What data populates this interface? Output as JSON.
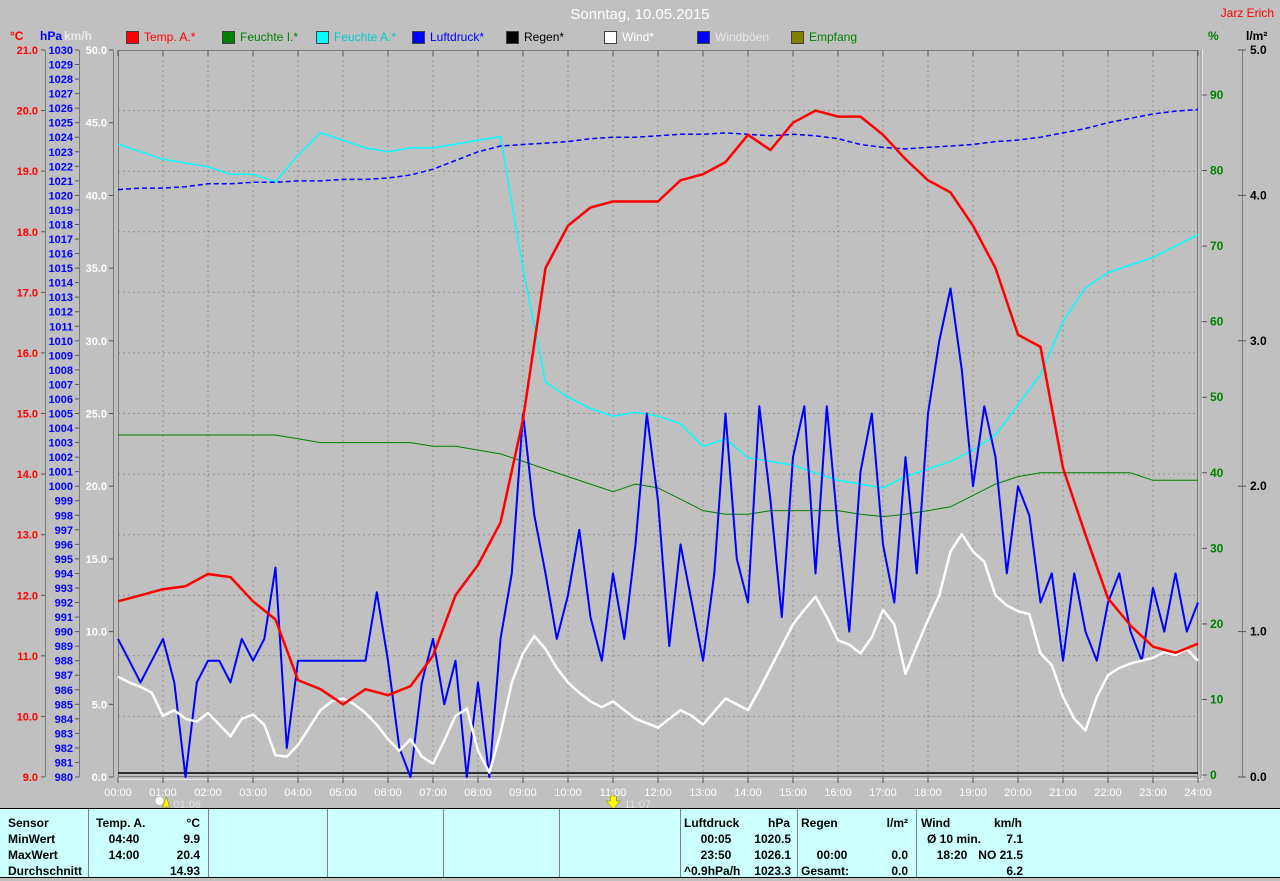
{
  "window": {
    "title": "Sonntag, 10.05.2015",
    "author": "Jarz Erich"
  },
  "header": {
    "units_left": [
      {
        "label": "°C",
        "color": "#ff0000"
      },
      {
        "label": "hPa",
        "color": "#0000ff"
      },
      {
        "label": "km/h",
        "color": "#e8e8e8"
      }
    ],
    "units_right": [
      {
        "label": "%",
        "color": "#008000"
      },
      {
        "label": "l/m²",
        "color": "#000000"
      }
    ]
  },
  "legend": {
    "items": [
      {
        "label": "Temp. A.*",
        "swatch": "#ff0000",
        "text_color": "#ff0000"
      },
      {
        "label": "Feuchte I.*",
        "swatch": "#008000",
        "text_color": "#008000"
      },
      {
        "label": "Feuchte A.*",
        "swatch": "#00ffff",
        "text_color": "#00cccc"
      },
      {
        "label": "Luftdruck*",
        "swatch": "#0000ff",
        "text_color": "#0000ff"
      },
      {
        "label": "Regen*",
        "swatch": "#000000",
        "text_color": "#000000"
      },
      {
        "label": "Wind*",
        "swatch": "#ffffff",
        "text_color": "#ffffff"
      },
      {
        "label": "Windböen",
        "swatch": "#0000ff",
        "text_color": "#e8e8e8"
      },
      {
        "label": "Empfang",
        "swatch": "#808000",
        "text_color": "#008000"
      }
    ]
  },
  "markers": [
    {
      "time": "01:06",
      "icon": "moon-marker"
    },
    {
      "time": "11:07",
      "icon": "down-arrow-marker"
    }
  ],
  "chart_data": {
    "type": "line",
    "title": "Sonntag, 10.05.2015",
    "x": {
      "start_h": 0,
      "end_h": 24,
      "tick_step_h": 1,
      "tick_labels_format": "HH:00"
    },
    "grid": {
      "vertical": "hourly",
      "horizontal": "every 1 °C",
      "style": "dashed"
    },
    "axes": {
      "temp": {
        "unit": "°C",
        "min": 9,
        "max": 21,
        "step": 1,
        "color": "#ff0000",
        "side": "left"
      },
      "pressure": {
        "unit": "hPa",
        "min": 980,
        "max": 1030,
        "step": 1,
        "color": "#0000ff",
        "side": "left"
      },
      "wind": {
        "unit": "km/h",
        "min": 0,
        "max": 50,
        "step": 5,
        "color": "#ffffff",
        "side": "left"
      },
      "humidity": {
        "unit": "%",
        "min": 0,
        "max": 90,
        "step": 10,
        "color": "#008000",
        "side": "right"
      },
      "rain": {
        "unit": "l/m²",
        "min": 0,
        "max": 5,
        "step": 1,
        "color": "#000000",
        "side": "right"
      }
    },
    "series": [
      {
        "name": "Temp. A.",
        "axis": "temp",
        "color": "#ff0000",
        "width": 2.5,
        "style": "solid",
        "step_min": 30,
        "values": [
          11.9,
          12.0,
          12.1,
          12.15,
          12.35,
          12.3,
          11.9,
          11.6,
          10.6,
          10.45,
          10.2,
          10.45,
          10.35,
          10.5,
          11.0,
          12.0,
          12.5,
          13.2,
          14.9,
          17.4,
          18.1,
          18.4,
          18.5,
          18.5,
          18.5,
          18.85,
          18.95,
          19.15,
          19.6,
          19.35,
          19.8,
          20.0,
          19.9,
          19.9,
          19.6,
          19.2,
          18.85,
          18.65,
          18.1,
          17.4,
          16.3,
          16.1,
          14.1,
          13.0,
          11.95,
          11.5,
          11.15,
          11.05,
          11.2
        ]
      },
      {
        "name": "Feuchte I.",
        "axis": "humidity",
        "color": "#008000",
        "width": 1,
        "style": "solid",
        "step_min": 30,
        "values": [
          45,
          45,
          45,
          45,
          45,
          45,
          45,
          45,
          44.5,
          44,
          44,
          44,
          44,
          44,
          43.5,
          43.5,
          43,
          42.5,
          41.5,
          40.5,
          39.5,
          38.5,
          37.5,
          38.5,
          38,
          36.5,
          35,
          34.5,
          34.5,
          35,
          35,
          35,
          35,
          34.5,
          34.2,
          34.5,
          35,
          35.5,
          37,
          38.5,
          39.5,
          40,
          40,
          40,
          40,
          40,
          39,
          39,
          39
        ]
      },
      {
        "name": "Feuchte A.",
        "axis": "humidity",
        "color": "#00ffff",
        "width": 1.5,
        "style": "solid",
        "step_min": 30,
        "values": [
          83.5,
          82.5,
          81.5,
          81,
          80.5,
          79.5,
          79.5,
          78.5,
          82,
          85,
          84,
          83,
          82.5,
          83,
          83,
          83.5,
          84,
          84.5,
          67,
          52,
          50,
          48.5,
          47.5,
          48,
          47.5,
          46.5,
          43.5,
          44.5,
          42,
          41.5,
          41,
          40,
          39,
          38.5,
          38,
          39.5,
          40.5,
          41.5,
          43,
          45,
          49,
          53,
          60,
          64.5,
          66.5,
          67.5,
          68.5,
          70,
          71.5
        ]
      },
      {
        "name": "Luftdruck",
        "axis": "pressure",
        "color": "#0000ff",
        "width": 1.5,
        "style": "dashed",
        "step_min": 30,
        "values": [
          1020.4,
          1020.5,
          1020.5,
          1020.6,
          1020.8,
          1020.8,
          1020.9,
          1020.9,
          1021.0,
          1021.0,
          1021.1,
          1021.1,
          1021.2,
          1021.4,
          1021.8,
          1022.4,
          1023.0,
          1023.4,
          1023.5,
          1023.6,
          1023.7,
          1023.9,
          1024.0,
          1024.0,
          1024.1,
          1024.2,
          1024.2,
          1024.3,
          1024.2,
          1024.1,
          1024.2,
          1024.1,
          1023.9,
          1023.5,
          1023.3,
          1023.2,
          1023.3,
          1023.4,
          1023.5,
          1023.7,
          1023.8,
          1024.0,
          1024.3,
          1024.6,
          1025.0,
          1025.3,
          1025.6,
          1025.8,
          1025.9
        ]
      },
      {
        "name": "Regen",
        "axis": "rain",
        "color": "#000000",
        "width": 1.5,
        "style": "solid",
        "step_min": 1440,
        "values": [
          0,
          0
        ]
      },
      {
        "name": "Windböen",
        "axis": "wind",
        "color": "#0000ff",
        "width": 2,
        "style": "solid",
        "step_min": 15,
        "values": [
          9.5,
          8,
          6.5,
          8,
          9.5,
          6.5,
          0,
          6.5,
          8,
          8,
          6.5,
          9.5,
          8,
          9.5,
          14.4,
          2,
          8,
          8,
          8,
          8,
          8,
          8,
          8,
          12.7,
          8,
          2,
          0,
          6.5,
          9.5,
          5,
          8,
          0,
          6.5,
          0,
          9.5,
          14,
          25,
          18,
          14,
          9.5,
          12.5,
          17,
          11,
          8,
          14,
          9.5,
          16,
          25,
          19,
          9,
          16,
          12,
          8,
          14,
          25,
          15,
          12,
          25.5,
          19,
          11,
          22,
          25.5,
          14,
          25.5,
          17,
          10,
          21,
          25,
          16,
          12,
          22,
          14,
          25,
          30,
          33.6,
          28,
          20,
          25.5,
          22,
          14,
          20,
          18,
          12,
          14,
          8,
          14,
          10,
          8,
          12,
          14,
          10,
          8,
          13,
          10,
          14,
          10,
          12
        ]
      },
      {
        "name": "Wind",
        "axis": "wind",
        "color": "#ffffff",
        "width": 2.5,
        "style": "solid",
        "step_min": 15,
        "values": [
          6.9,
          6.5,
          6.2,
          5.8,
          4.2,
          4.6,
          4.0,
          3.8,
          4.4,
          3.6,
          2.8,
          4.0,
          4.3,
          3.6,
          1.5,
          1.4,
          2.2,
          3.4,
          4.6,
          5.2,
          5.4,
          5.0,
          4.4,
          3.6,
          2.6,
          1.8,
          2.6,
          1.4,
          0.9,
          2.5,
          4.2,
          4.7,
          1.8,
          0.3,
          3.0,
          6.5,
          8.5,
          9.7,
          8.8,
          7.5,
          6.5,
          5.8,
          5.2,
          4.8,
          5.2,
          4.6,
          4.0,
          3.7,
          3.4,
          4.0,
          4.6,
          4.2,
          3.6,
          4.5,
          5.4,
          5.0,
          4.6,
          6.0,
          7.5,
          9.0,
          10.5,
          11.5,
          12.4,
          11.0,
          9.4,
          9.1,
          8.5,
          9.6,
          11.5,
          10.5,
          7.1,
          9.0,
          10.8,
          12.5,
          15.5,
          16.7,
          15.5,
          14.8,
          12.5,
          11.8,
          11.4,
          11.2,
          8.5,
          7.7,
          5.5,
          4.0,
          3.2,
          5.5,
          7.0,
          7.5,
          7.8,
          8.0,
          8.2,
          8.6,
          8.4,
          8.8,
          8.0
        ]
      }
    ]
  },
  "table": {
    "row_labels": [
      "Sensor",
      "MinWert",
      "MaxWert",
      "Durchschnitt"
    ],
    "temp": {
      "header": "Temp. A.",
      "unit": "°C",
      "min_time": "04:40",
      "min": "9.9",
      "max_time": "14:00",
      "max": "20.4",
      "avg": "14.93"
    },
    "pressure": {
      "header": "Luftdruck",
      "unit": "hPa",
      "min_time": "00:05",
      "min": "1020.5",
      "max_time": "23:50",
      "max": "1026.1",
      "trend": "^0.9hPa/h",
      "avg": "1023.3"
    },
    "rain": {
      "header": "Regen",
      "unit": "l/m²",
      "max_time": "00:00",
      "max": "0.0",
      "total_label": "Gesamt:",
      "total": "0.0"
    },
    "wind": {
      "header": "Wind",
      "unit": "km/h",
      "min_label": "Ø 10 min.",
      "min": "7.1",
      "max_time": "18:20",
      "max": "NO 21.5",
      "avg": "6.2"
    }
  }
}
